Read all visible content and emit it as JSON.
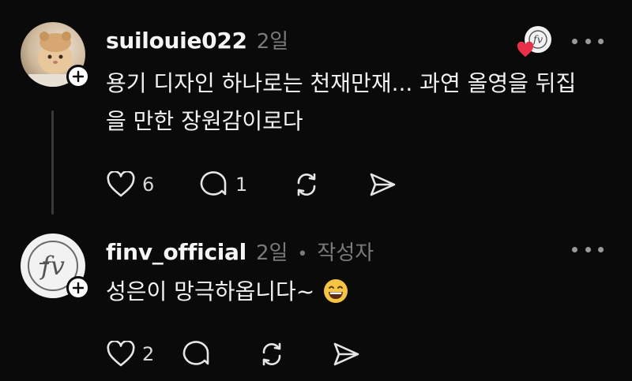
{
  "posts": [
    {
      "username": "suilouie022",
      "time": "2일",
      "text": "용기 디자인 하나로는 천재만재... 과연 올영을 뒤집을 만한 장원감이로다",
      "likes": "6",
      "replies": "1",
      "avatar_icon": "cat-photo",
      "liked_by_icon": "finv-logo-icon"
    },
    {
      "username": "finv_official",
      "time": "2일",
      "dot": "•",
      "author_tag": "작성자",
      "text": "성은이 망극하옵니다~",
      "likes": "2",
      "avatar_icon": "finv-logo-icon"
    }
  ],
  "colors": {
    "background": "#0a0a0a",
    "text": "#f3f3f3",
    "muted": "#7a7a7a",
    "heart": "#e8304a"
  }
}
